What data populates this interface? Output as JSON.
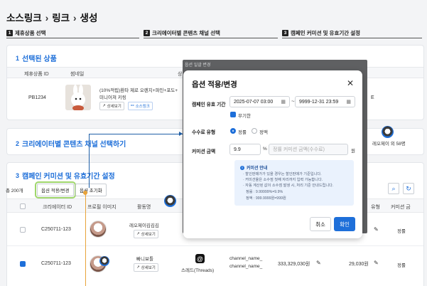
{
  "breadcrumb": {
    "items": [
      "소스링크",
      "링크",
      "생성"
    ]
  },
  "steps": [
    {
      "num": "1",
      "label": "제휴상품 선택"
    },
    {
      "num": "2",
      "label": "크리에이터별 콘텐츠 채널 선택"
    },
    {
      "num": "3",
      "label": "캠페인 커미션 및 유효기간 설정"
    }
  ],
  "section1": {
    "num": "1",
    "title": "선택된 상품",
    "columns": {
      "product_id": "제휴상품 ID",
      "thumbnail": "썸네일",
      "name_partial": "상"
    },
    "product": {
      "id": "PB1234",
      "name_line1": "(10%적립)환타 제로 오렌지+파인+포도+",
      "name_line2": "미니어쳐 키링",
      "detail_btn": "상세보기",
      "sourcelink_btn": "소스링크",
      "trailing": "E"
    }
  },
  "section2": {
    "num": "2",
    "title": "크리에이터별 콘텐츠 채널 선택하기",
    "right_info": "레오제이 외 58명"
  },
  "section3": {
    "num": "3",
    "title": "캠페인 커미션 및 유효기간 설정",
    "total_prefix": "총 200개",
    "toolbar": {
      "apply_btn": "옵션 적용/변경",
      "reset_btn": "옵션 초기화"
    },
    "columns": {
      "creator_id": "크리에이터 ID",
      "profile": "프로필 이미지",
      "name": "활동명",
      "type": "유형",
      "commission_partial": "커미션 금"
    },
    "rows": [
      {
        "checked": false,
        "creator_id": "C250711-123",
        "name": "레오제이김김김",
        "detail_btn": "상세보기",
        "type": "정률"
      },
      {
        "checked": true,
        "creator_id": "C250711-123",
        "name": "빠니보틀",
        "detail_btn": "상세보기",
        "platform": "스레드(Threads)",
        "channel1": "channel_name_",
        "channel2": "channel_name_",
        "sales": "333,329,030원",
        "commission": "29,030원",
        "type": "정률"
      }
    ]
  },
  "modal": {
    "overlay_title": "옵션 일괄 변경",
    "title": "옵션 적용/변경",
    "period_label": "캠페인 유효 기간",
    "start_date": "2025-07-07 03:00",
    "end_date": "9999-12-31 23:59",
    "unlimited_label": "무기한",
    "fee_type_label": "수수료 유형",
    "fee_types": [
      "정률",
      "정액"
    ],
    "amount_label": "커미션 금액",
    "amount_value": "9.9",
    "percent_unit": "%",
    "amount_placeholder": "정률 커미션 금액(수수료)",
    "won_unit": "원",
    "info_title": "커미션 안내",
    "info_lines": [
      "· 할인판매가가 있을 경우는 할인판매가 기준입니다.",
      "· 커미션율은 소수점 첫째 자리까지 입력 가능합니다.",
      "· 자동 계산된 값이 소수점 발생 시, 처리 기준 안내드립니다.",
      "정률 : 9.99999%=9.9%",
      "정액 : 999.9999원=999원"
    ],
    "cancel_btn": "취소",
    "ok_btn": "확인"
  },
  "colors": {
    "accent": "#1e6fd9",
    "highlight": "#9fd66b",
    "connector": "#1f5fa8",
    "connector_alt": "#e8a33a"
  }
}
